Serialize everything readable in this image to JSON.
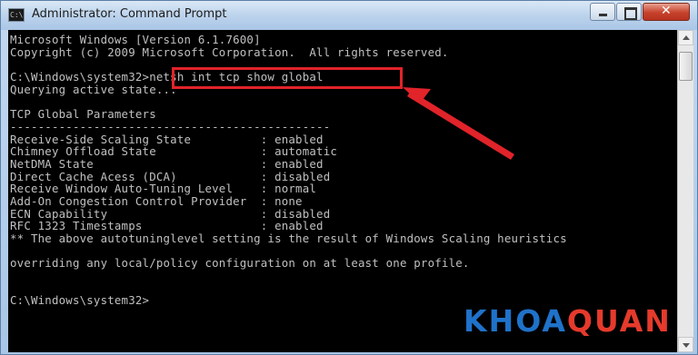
{
  "window": {
    "title": "Administrator: Command Prompt",
    "icon_text": "C:\\",
    "icon_name": "cmd-icon"
  },
  "console": {
    "lines": [
      "Microsoft Windows [Version 6.1.7600]",
      "Copyright (c) 2009 Microsoft Corporation.  All rights reserved.",
      "",
      "C:\\Windows\\system32>netsh int tcp show global",
      "Querying active state...",
      "",
      "TCP Global Parameters",
      "----------------------------------------------",
      "Receive-Side Scaling State          : enabled",
      "Chimney Offload State               : automatic",
      "NetDMA State                        : enabled",
      "Direct Cache Acess (DCA)            : disabled",
      "Receive Window Auto-Tuning Level    : normal",
      "Add-On Congestion Control Provider  : none",
      "ECN Capability                      : disabled",
      "RFC 1323 Timestamps                 : enabled",
      "** The above autotuninglevel setting is the result of Windows Scaling heuristics",
      "",
      "overriding any local/policy configuration on at least one profile.",
      "",
      "",
      "C:\\Windows\\system32>"
    ]
  },
  "annotation": {
    "highlight_color": "#e1232a"
  },
  "watermark": {
    "part1": "KHOA",
    "part2": "QUAN",
    "color1": "#1f72c9",
    "color2": "#e53a2c"
  }
}
